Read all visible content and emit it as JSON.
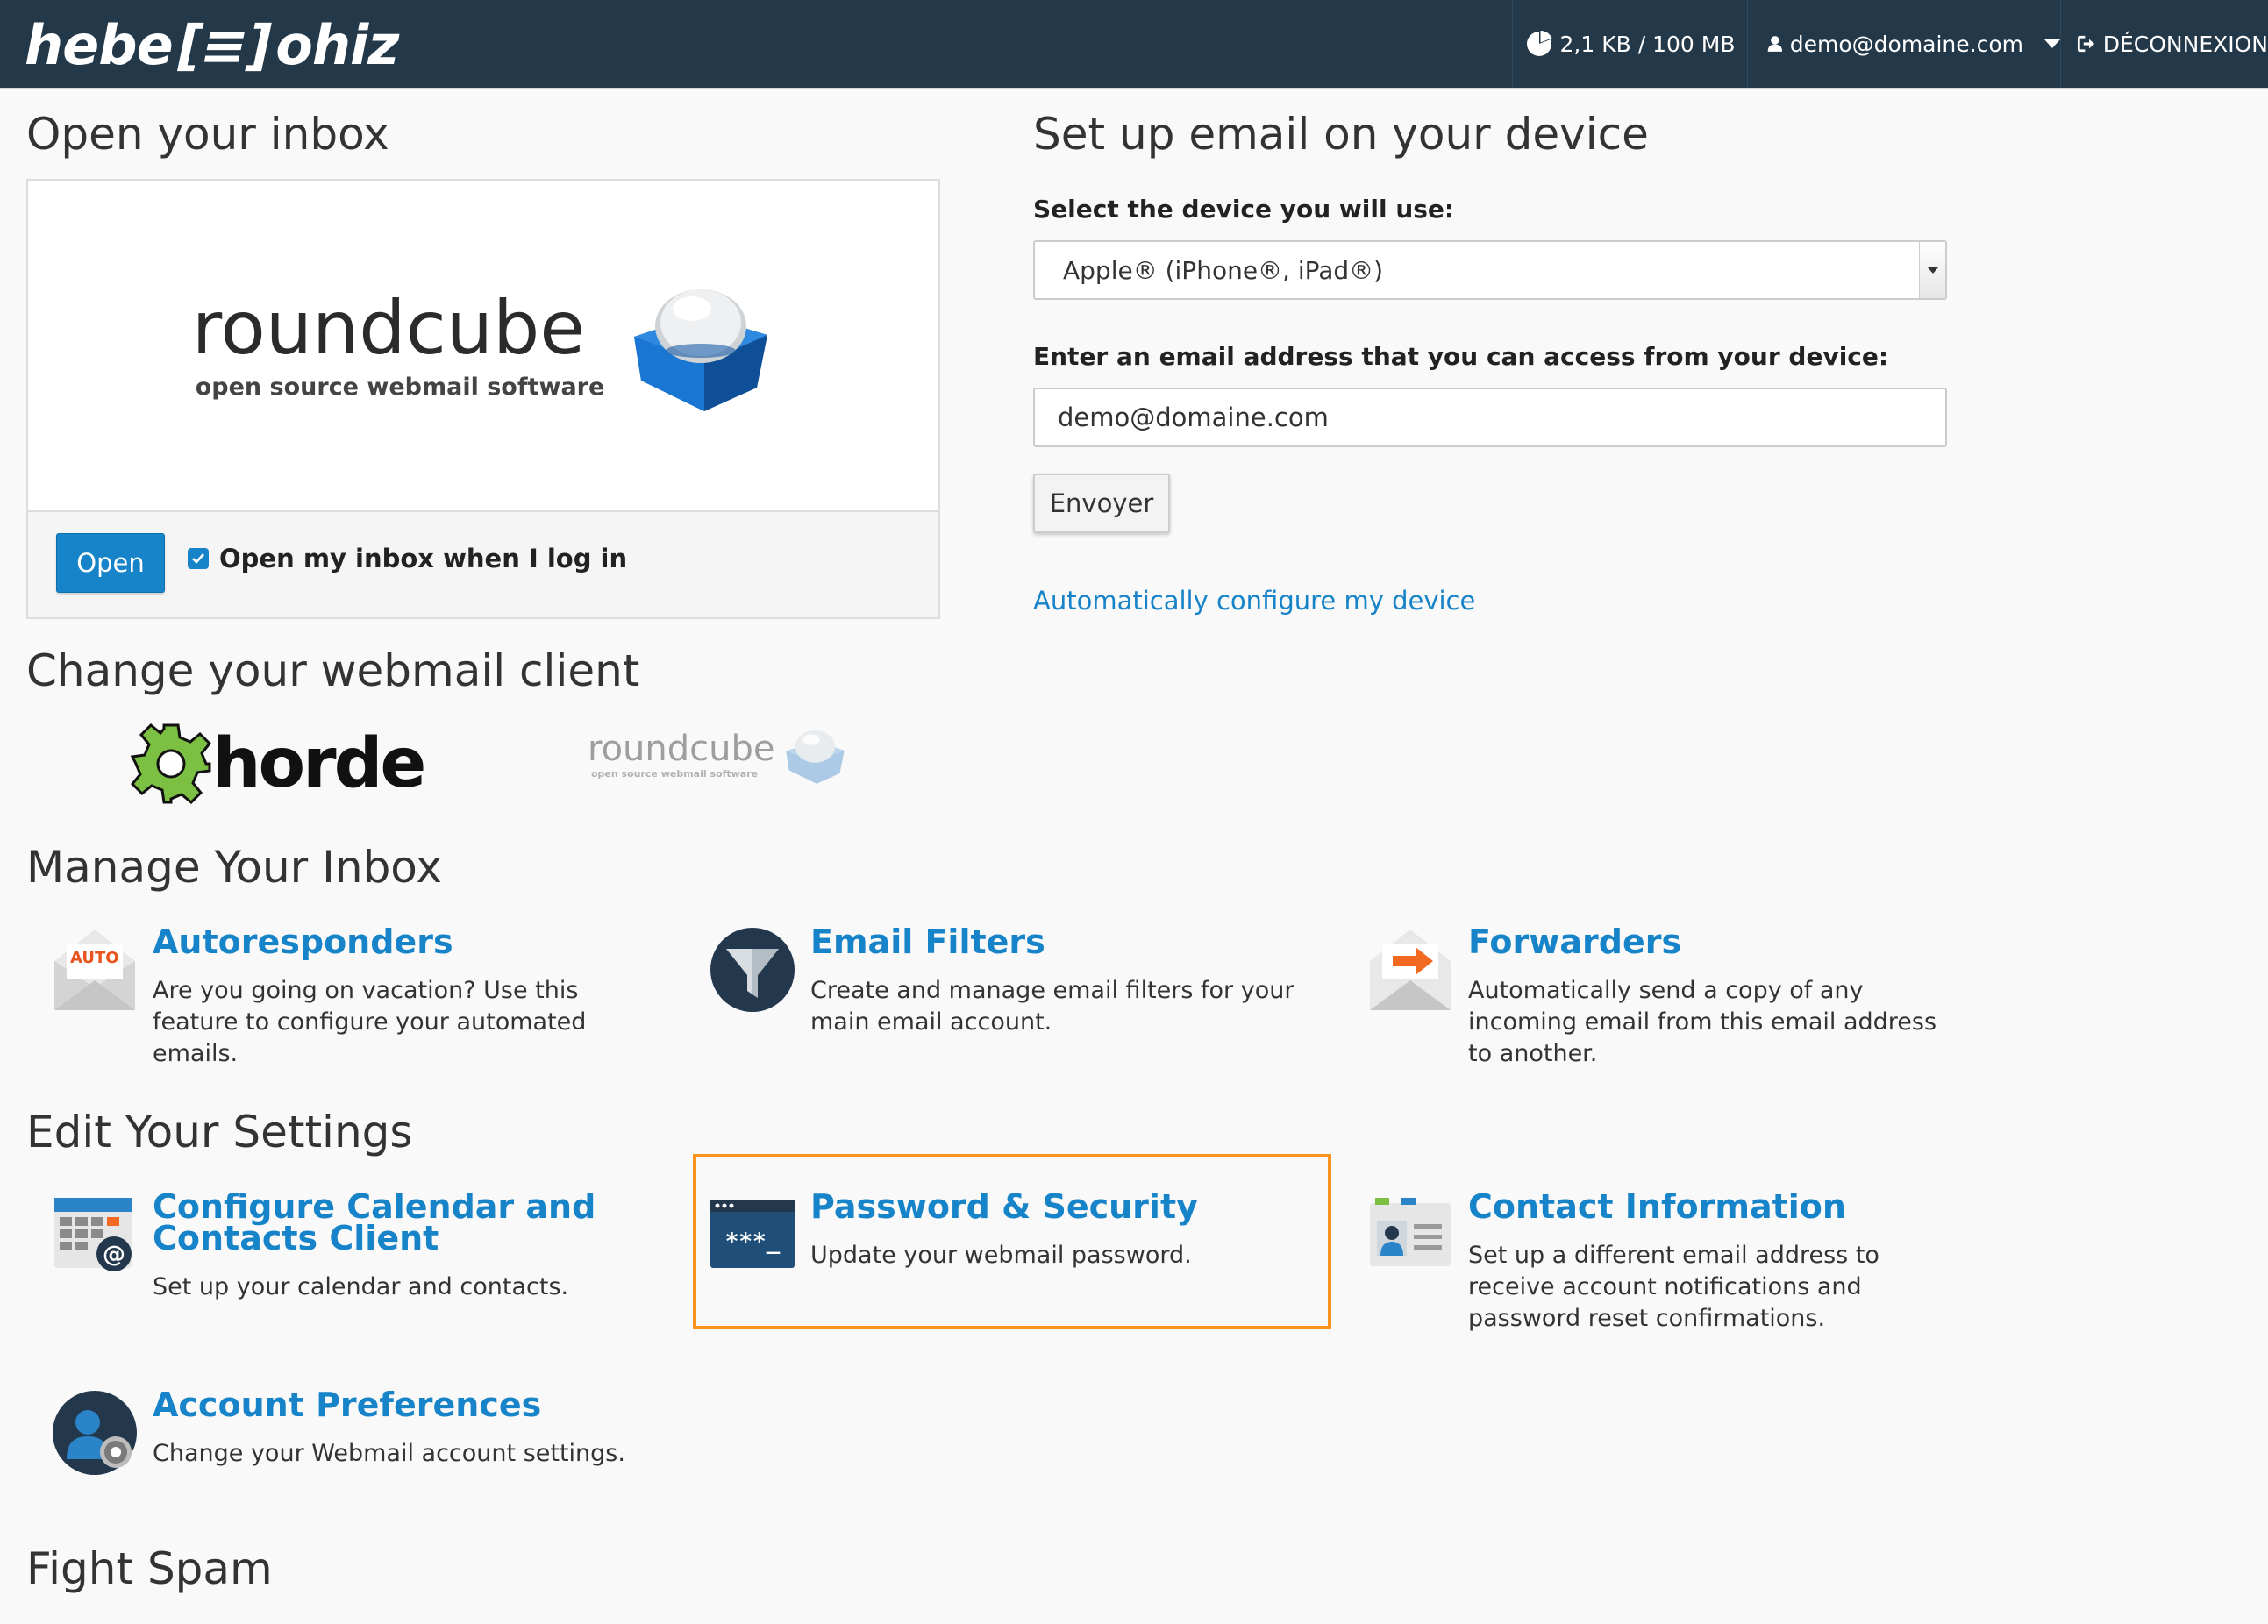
{
  "topbar": {
    "brand_left": "hebe",
    "brand_mid": "[≡]",
    "brand_right": "ohiz",
    "disk_usage": "2,1 KB / 100 MB",
    "user_email": "demo@domaine.com",
    "logout": "DÉCONNEXION"
  },
  "open_inbox": {
    "title": "Open your inbox",
    "logo_word": "roundcube",
    "logo_sub": "open source webmail software",
    "open_button": "Open",
    "checkbox_label": "Open my inbox when I log in",
    "checkbox_checked": true
  },
  "device_setup": {
    "title": "Set up email on your device",
    "select_label": "Select the device you will use:",
    "selected_device": "Apple® (iPhone®, iPad®)",
    "email_label": "Enter an email address that you can access from your device:",
    "email_value": "demo@domaine.com",
    "send_button": "Envoyer",
    "auto_link": "Automatically configure my device"
  },
  "webmail_client": {
    "title": "Change your webmail client",
    "horde_word": "horde",
    "roundcube_word": "roundcube",
    "roundcube_sub": "open source webmail software"
  },
  "manage_inbox": {
    "title": "Manage Your Inbox",
    "items": [
      {
        "title": "Autoresponders",
        "desc": "Are you going on vacation? Use this feature to configure your automated emails.",
        "icon": "autoresponder-icon",
        "badge": "AUTO"
      },
      {
        "title": "Email Filters",
        "desc": "Create and manage email filters for your main email account.",
        "icon": "filter-icon"
      },
      {
        "title": "Forwarders",
        "desc": "Automatically send a copy of any incoming email from this email address to another.",
        "icon": "forwarder-icon"
      }
    ]
  },
  "edit_settings": {
    "title": "Edit Your Settings",
    "items": [
      {
        "title": "Configure Calendar and Contacts Client",
        "desc": "Set up your calendar and contacts.",
        "icon": "calendar-icon"
      },
      {
        "title": "Password & Security",
        "desc": "Update your webmail password.",
        "icon": "password-icon",
        "icon_text": "***_"
      },
      {
        "title": "Contact Information",
        "desc": "Set up a different email address to receive account notifications and password reset confirmations.",
        "icon": "contact-card-icon"
      },
      {
        "title": "Account Preferences",
        "desc": "Change your Webmail account settings.",
        "icon": "account-preferences-icon"
      }
    ]
  },
  "fight_spam": {
    "title": "Fight Spam"
  },
  "colors": {
    "topbar": "#233849",
    "link": "#1783c8",
    "highlight": "#f7931e"
  }
}
